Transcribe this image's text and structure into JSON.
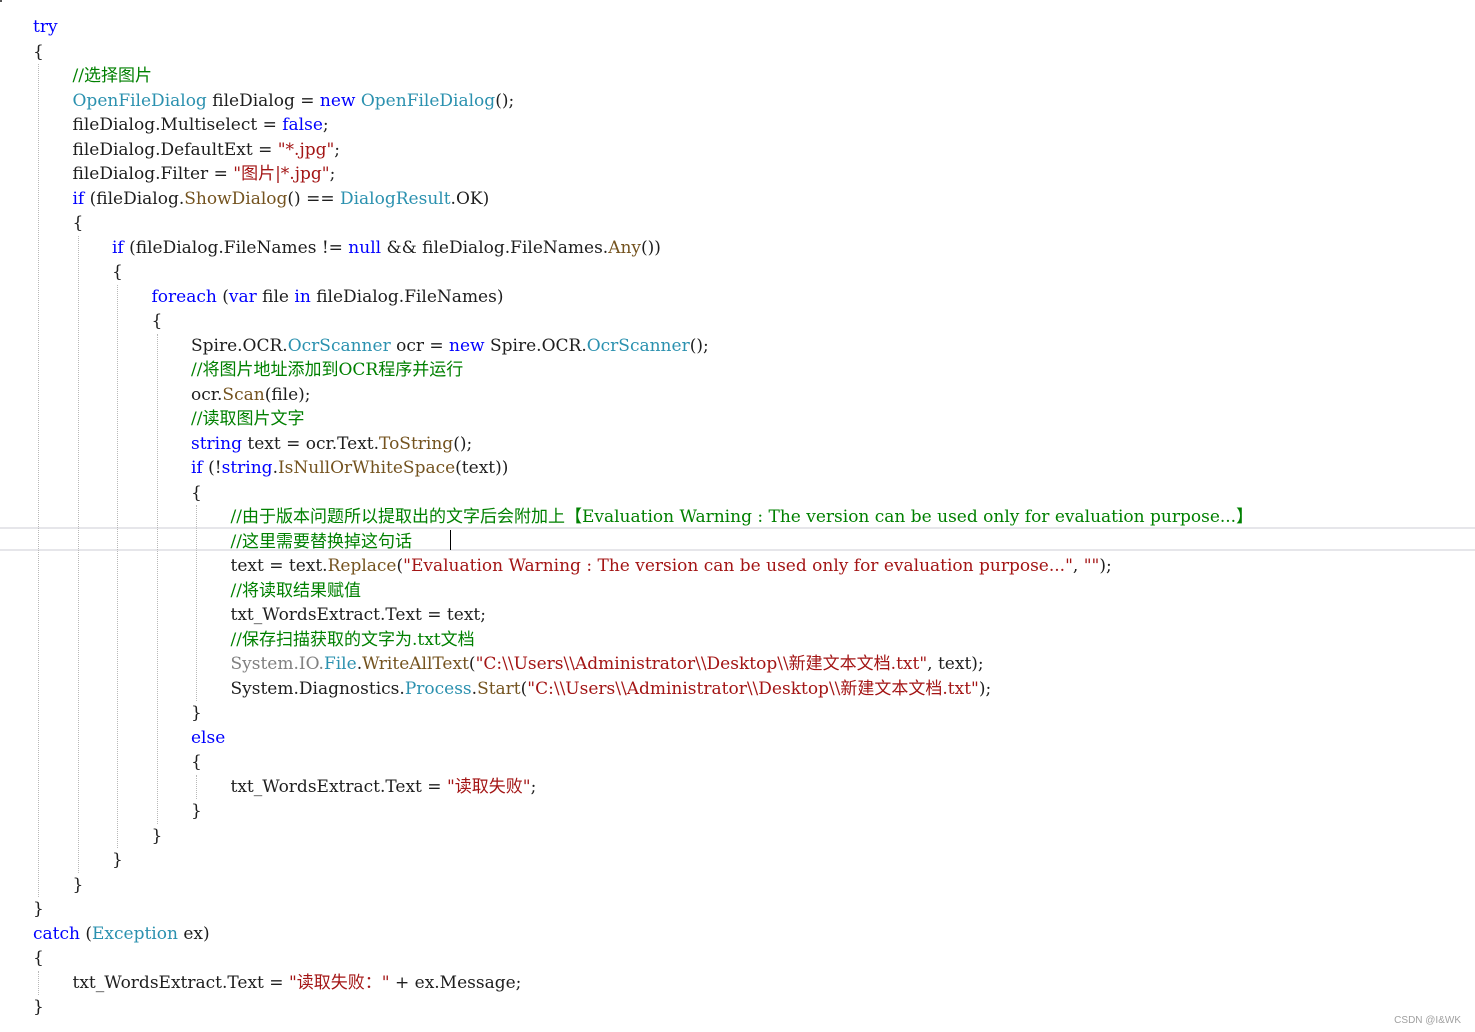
{
  "colors": {
    "keyword": "#0000ff",
    "type": "#2b91af",
    "string": "#a31515",
    "comment": "#008000",
    "method": "#74531f",
    "plain": "#1e1e1e",
    "gray": "#808080"
  },
  "code": {
    "lines": [
      {
        "indent": 0,
        "tokens": [
          {
            "t": "try",
            "c": "keyword"
          }
        ]
      },
      {
        "indent": 0,
        "tokens": [
          {
            "t": "{",
            "c": "plain"
          }
        ]
      },
      {
        "indent": 1,
        "tokens": [
          {
            "t": "//选择图片",
            "c": "comment"
          }
        ]
      },
      {
        "indent": 1,
        "tokens": [
          {
            "t": "OpenFileDialog",
            "c": "type"
          },
          {
            "t": " fileDialog = ",
            "c": "plain"
          },
          {
            "t": "new",
            "c": "keyword"
          },
          {
            "t": " ",
            "c": "plain"
          },
          {
            "t": "OpenFileDialog",
            "c": "type"
          },
          {
            "t": "();",
            "c": "plain"
          }
        ]
      },
      {
        "indent": 1,
        "tokens": [
          {
            "t": "fileDialog.Multiselect = ",
            "c": "plain"
          },
          {
            "t": "false",
            "c": "keyword"
          },
          {
            "t": ";",
            "c": "plain"
          }
        ]
      },
      {
        "indent": 1,
        "tokens": [
          {
            "t": "fileDialog.DefaultExt = ",
            "c": "plain"
          },
          {
            "t": "\"*.jpg\"",
            "c": "string"
          },
          {
            "t": ";",
            "c": "plain"
          }
        ]
      },
      {
        "indent": 1,
        "tokens": [
          {
            "t": "fileDialog.Filter = ",
            "c": "plain"
          },
          {
            "t": "\"图片|*.jpg\"",
            "c": "string"
          },
          {
            "t": ";",
            "c": "plain"
          }
        ]
      },
      {
        "indent": 1,
        "tokens": [
          {
            "t": "if",
            "c": "keyword"
          },
          {
            "t": " (fileDialog.",
            "c": "plain"
          },
          {
            "t": "ShowDialog",
            "c": "method"
          },
          {
            "t": "() == ",
            "c": "plain"
          },
          {
            "t": "DialogResult",
            "c": "type"
          },
          {
            "t": ".OK)",
            "c": "plain"
          }
        ]
      },
      {
        "indent": 1,
        "tokens": [
          {
            "t": "{",
            "c": "plain"
          }
        ]
      },
      {
        "indent": 2,
        "tokens": [
          {
            "t": "if",
            "c": "keyword"
          },
          {
            "t": " (fileDialog.FileNames != ",
            "c": "plain"
          },
          {
            "t": "null",
            "c": "keyword"
          },
          {
            "t": " && fileDialog.FileNames.",
            "c": "plain"
          },
          {
            "t": "Any",
            "c": "method"
          },
          {
            "t": "())",
            "c": "plain"
          }
        ]
      },
      {
        "indent": 2,
        "tokens": [
          {
            "t": "{",
            "c": "plain"
          }
        ]
      },
      {
        "indent": 3,
        "tokens": [
          {
            "t": "foreach",
            "c": "keyword"
          },
          {
            "t": " (",
            "c": "plain"
          },
          {
            "t": "var",
            "c": "keyword"
          },
          {
            "t": " file ",
            "c": "plain"
          },
          {
            "t": "in",
            "c": "keyword"
          },
          {
            "t": " fileDialog.FileNames)",
            "c": "plain"
          }
        ]
      },
      {
        "indent": 3,
        "tokens": [
          {
            "t": "{",
            "c": "plain"
          }
        ]
      },
      {
        "indent": 4,
        "tokens": [
          {
            "t": "Spire.OCR.",
            "c": "plain"
          },
          {
            "t": "OcrScanner",
            "c": "type"
          },
          {
            "t": " ocr = ",
            "c": "plain"
          },
          {
            "t": "new",
            "c": "keyword"
          },
          {
            "t": " Spire.OCR.",
            "c": "plain"
          },
          {
            "t": "OcrScanner",
            "c": "type"
          },
          {
            "t": "();",
            "c": "plain"
          }
        ]
      },
      {
        "indent": 4,
        "tokens": [
          {
            "t": "//将图片地址添加到OCR程序并运行",
            "c": "comment"
          }
        ]
      },
      {
        "indent": 4,
        "tokens": [
          {
            "t": "ocr.",
            "c": "plain"
          },
          {
            "t": "Scan",
            "c": "method"
          },
          {
            "t": "(file);",
            "c": "plain"
          }
        ]
      },
      {
        "indent": 4,
        "tokens": [
          {
            "t": "//读取图片文字",
            "c": "comment"
          }
        ]
      },
      {
        "indent": 4,
        "tokens": [
          {
            "t": "string",
            "c": "keyword"
          },
          {
            "t": " text = ocr.Text.",
            "c": "plain"
          },
          {
            "t": "ToString",
            "c": "method"
          },
          {
            "t": "();",
            "c": "plain"
          }
        ]
      },
      {
        "indent": 4,
        "tokens": [
          {
            "t": "if",
            "c": "keyword"
          },
          {
            "t": " (!",
            "c": "plain"
          },
          {
            "t": "string",
            "c": "keyword"
          },
          {
            "t": ".",
            "c": "plain"
          },
          {
            "t": "IsNullOrWhiteSpace",
            "c": "method"
          },
          {
            "t": "(text))",
            "c": "plain"
          }
        ]
      },
      {
        "indent": 4,
        "tokens": [
          {
            "t": "{",
            "c": "plain"
          }
        ]
      },
      {
        "indent": 5,
        "tokens": [
          {
            "t": "//由于版本问题所以提取出的文字后会附加上【Evaluation Warning : The version can be used only for evaluation purpose...】",
            "c": "comment"
          }
        ]
      },
      {
        "indent": 5,
        "tokens": [
          {
            "t": "//这里需要替换掉这句话",
            "c": "comment"
          }
        ]
      },
      {
        "indent": 5,
        "tokens": [
          {
            "t": "text = text.",
            "c": "plain"
          },
          {
            "t": "Replace",
            "c": "method"
          },
          {
            "t": "(",
            "c": "plain"
          },
          {
            "t": "\"Evaluation Warning : The version can be used only for evaluation purpose...\"",
            "c": "string"
          },
          {
            "t": ", ",
            "c": "plain"
          },
          {
            "t": "\"\"",
            "c": "string"
          },
          {
            "t": ");",
            "c": "plain"
          }
        ]
      },
      {
        "indent": 5,
        "tokens": [
          {
            "t": "//将读取结果赋值",
            "c": "comment"
          }
        ]
      },
      {
        "indent": 5,
        "tokens": [
          {
            "t": "txt_WordsExtract.Text = text;",
            "c": "plain"
          }
        ]
      },
      {
        "indent": 5,
        "tokens": [
          {
            "t": "//保存扫描获取的文字为.txt文档",
            "c": "comment"
          }
        ]
      },
      {
        "indent": 5,
        "tokens": [
          {
            "t": "System.IO.",
            "c": "gray"
          },
          {
            "t": "File",
            "c": "type"
          },
          {
            "t": ".",
            "c": "plain"
          },
          {
            "t": "WriteAllText",
            "c": "method"
          },
          {
            "t": "(",
            "c": "plain"
          },
          {
            "t": "\"C:\\\\Users\\\\Administrator\\\\Desktop\\\\新建文本文档.txt\"",
            "c": "string"
          },
          {
            "t": ", text);",
            "c": "plain"
          }
        ]
      },
      {
        "indent": 5,
        "tokens": [
          {
            "t": "System.Diagnostics.",
            "c": "plain"
          },
          {
            "t": "Process",
            "c": "type"
          },
          {
            "t": ".",
            "c": "plain"
          },
          {
            "t": "Start",
            "c": "method"
          },
          {
            "t": "(",
            "c": "plain"
          },
          {
            "t": "\"C:\\\\Users\\\\Administrator\\\\Desktop\\\\新建文本文档.txt\"",
            "c": "string"
          },
          {
            "t": ");",
            "c": "plain"
          }
        ]
      },
      {
        "indent": 4,
        "tokens": [
          {
            "t": "}",
            "c": "plain"
          }
        ]
      },
      {
        "indent": 4,
        "tokens": [
          {
            "t": "else",
            "c": "keyword"
          }
        ]
      },
      {
        "indent": 4,
        "tokens": [
          {
            "t": "{",
            "c": "plain"
          }
        ]
      },
      {
        "indent": 5,
        "tokens": [
          {
            "t": "txt_WordsExtract.Text = ",
            "c": "plain"
          },
          {
            "t": "\"读取失败\"",
            "c": "string"
          },
          {
            "t": ";",
            "c": "plain"
          }
        ]
      },
      {
        "indent": 4,
        "tokens": [
          {
            "t": "}",
            "c": "plain"
          }
        ]
      },
      {
        "indent": 3,
        "tokens": [
          {
            "t": "}",
            "c": "plain"
          }
        ]
      },
      {
        "indent": 2,
        "tokens": [
          {
            "t": "}",
            "c": "plain"
          }
        ]
      },
      {
        "indent": 1,
        "tokens": [
          {
            "t": "}",
            "c": "plain"
          }
        ]
      },
      {
        "indent": 0,
        "tokens": [
          {
            "t": "}",
            "c": "plain"
          }
        ]
      },
      {
        "indent": 0,
        "tokens": [
          {
            "t": "catch",
            "c": "keyword"
          },
          {
            "t": " (",
            "c": "plain"
          },
          {
            "t": "Exception",
            "c": "type"
          },
          {
            "t": " ex)",
            "c": "plain"
          }
        ]
      },
      {
        "indent": 0,
        "tokens": [
          {
            "t": "{",
            "c": "plain"
          }
        ]
      },
      {
        "indent": 1,
        "tokens": [
          {
            "t": "txt_WordsExtract.Text = ",
            "c": "plain"
          },
          {
            "t": "\"读取失败：\"",
            "c": "string"
          },
          {
            "t": " + ex.Message;",
            "c": "plain"
          }
        ]
      },
      {
        "indent": 0,
        "tokens": [
          {
            "t": "}",
            "c": "plain"
          }
        ]
      }
    ]
  },
  "watermark": "CSDN @I&WK"
}
